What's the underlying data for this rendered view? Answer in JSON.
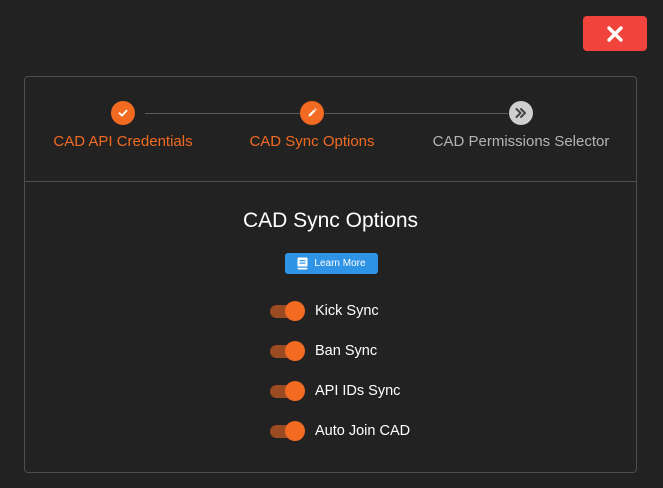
{
  "dialog": {
    "close_icon": "close-x-icon"
  },
  "stepper": {
    "steps": [
      {
        "label": "CAD API Credentials",
        "state": "completed",
        "icon": "check-icon"
      },
      {
        "label": "CAD Sync Options",
        "state": "active",
        "icon": "pencil-icon"
      },
      {
        "label": "CAD Permissions Selector",
        "state": "pending",
        "icon": "chevrons-right-icon"
      }
    ]
  },
  "main": {
    "title": "CAD Sync Options",
    "learn_more_label": "Learn More",
    "learn_more_icon": "book-icon",
    "options": [
      {
        "label": "Kick Sync",
        "enabled": true
      },
      {
        "label": "Ban Sync",
        "enabled": true
      },
      {
        "label": "API IDs Sync",
        "enabled": true
      },
      {
        "label": "Auto Join CAD",
        "enabled": true
      }
    ]
  },
  "colors": {
    "accent": "#f26b21",
    "accent_dark": "#9a4b21",
    "close_button": "#f0443c",
    "learn_more_button": "#2f93e6",
    "background": "#222222",
    "border": "#4e4e4e",
    "pending_text": "#b4b4b4"
  }
}
